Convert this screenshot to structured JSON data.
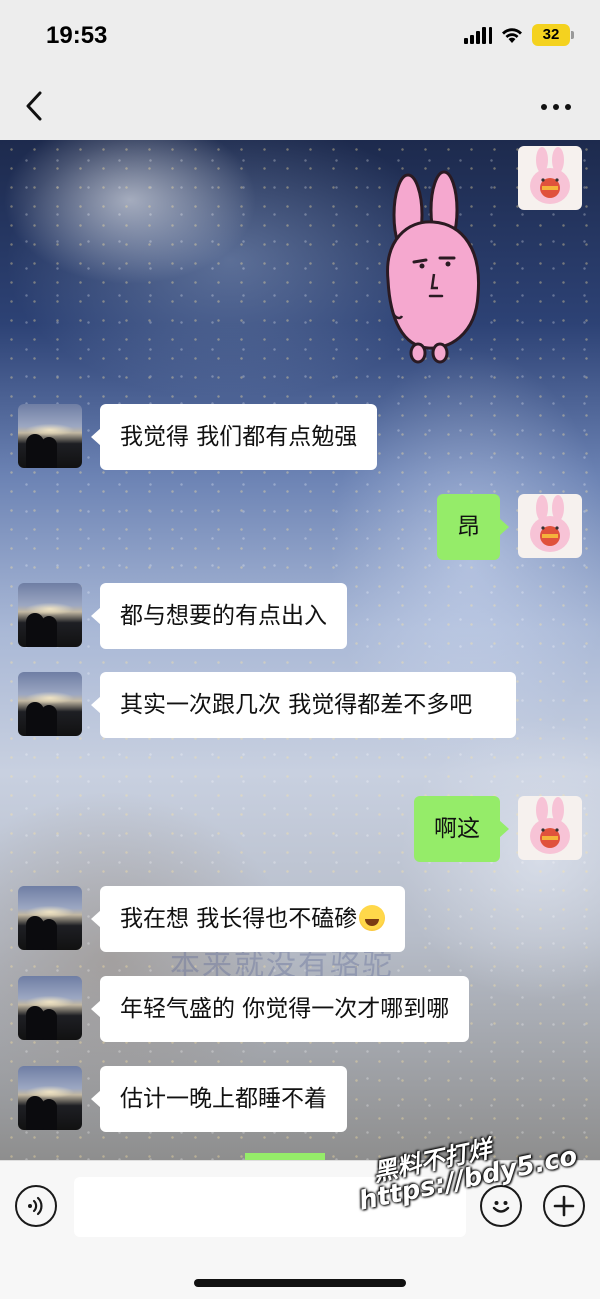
{
  "status_bar": {
    "time": "19:53",
    "battery": "32",
    "icons": [
      "signal-icon",
      "wifi-icon",
      "battery-icon"
    ]
  },
  "nav": {
    "back_icon": "chevron-left-icon",
    "more_icon": "more-dots-icon"
  },
  "colors": {
    "self_bubble": "#95ec69",
    "peer_bubble": "#ffffff",
    "battery": "#f4d21f"
  },
  "messages": [
    {
      "from": "self",
      "kind": "sticker",
      "sticker": "pink-rabbit-sticker"
    },
    {
      "from": "peer",
      "text": "我觉得 我们都有点勉强"
    },
    {
      "from": "self",
      "text": "昂"
    },
    {
      "from": "peer",
      "text": "都与想要的有点出入"
    },
    {
      "from": "peer",
      "text": "其实一次跟几次 我觉得都差不多吧"
    },
    {
      "from": "self",
      "text": "啊这"
    },
    {
      "from": "peer",
      "text": "我在想 我长得也不磕碜",
      "emoji": "laughing-tears-emoji"
    },
    {
      "from": "peer",
      "text": "年轻气盛的 你觉得一次才哪到哪"
    },
    {
      "from": "peer",
      "text": "估计一晚上都睡不着"
    }
  ],
  "background_text": "本来就没有骆驼",
  "input_bar": {
    "voice_icon": "voice-icon",
    "emoji_icon": "emoji-icon",
    "plus_icon": "plus-icon",
    "input_value": ""
  },
  "watermark": {
    "line1": "黑料不打烊",
    "line2": "https://bdy5.co"
  }
}
